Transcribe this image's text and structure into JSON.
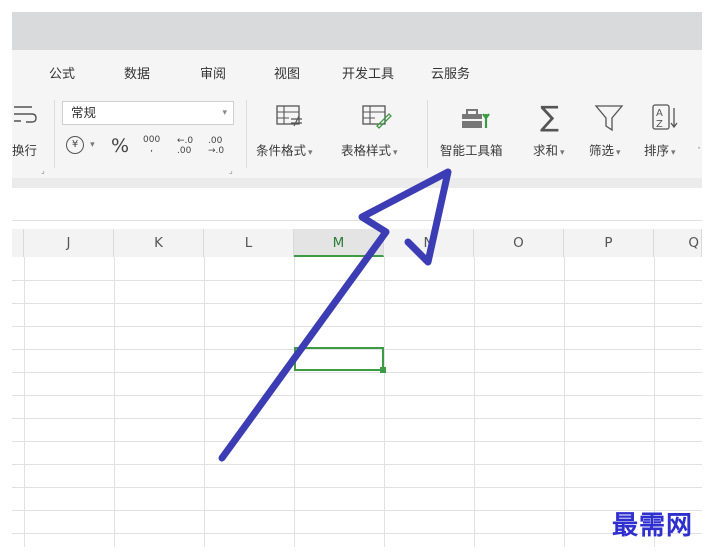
{
  "menu": {
    "formula": "公式",
    "data": "数据",
    "review": "审阅",
    "view": "视图",
    "developer": "开发工具",
    "cloud": "云服务"
  },
  "ribbon": {
    "wrap_label": "换行",
    "number_format": "常规",
    "currency_symbol": "¥",
    "percent_symbol": "%",
    "thousands": "000",
    "inc_decimal": ".00",
    "dec_decimal": ".0",
    "cond_format": "条件格式",
    "table_style": "表格样式",
    "smart_toolbox": "智能工具箱",
    "sum": "求和",
    "filter": "筛选",
    "sort": "排序"
  },
  "columns": [
    "J",
    "K",
    "L",
    "M",
    "N",
    "O",
    "P",
    "Q"
  ],
  "selected_column": "M",
  "watermark": "最需网",
  "colors": {
    "accent_green": "#3d9a45",
    "arrow_blue": "#3c3cb4",
    "watermark_blue": "#2f2fd0"
  }
}
